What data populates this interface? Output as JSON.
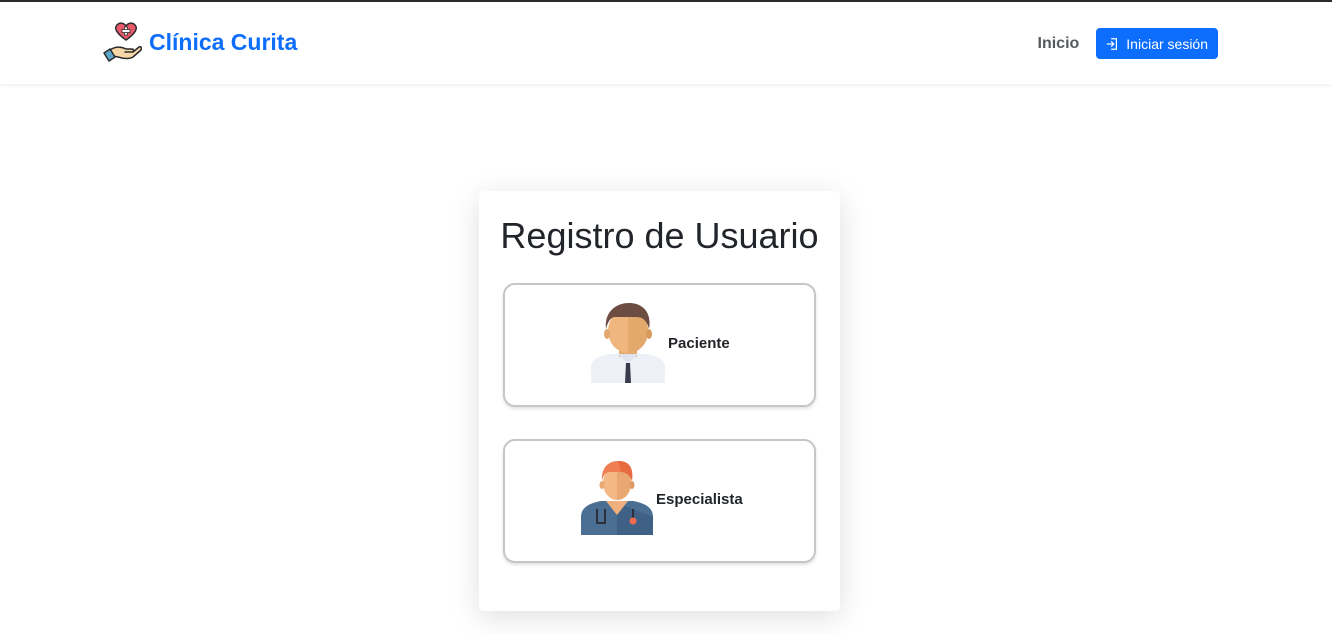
{
  "navbar": {
    "brand_name": "Clínica Curita",
    "brand_icon": "heart-hand-icon",
    "home_link": "Inicio",
    "login_button": "Iniciar sesión",
    "login_icon": "sign-in-icon",
    "brand_color": "#0d6efd"
  },
  "registration": {
    "title": "Registro de Usuario",
    "options": [
      {
        "label": "Paciente",
        "icon": "patient-avatar-icon"
      },
      {
        "label": "Especialista",
        "icon": "doctor-avatar-icon"
      }
    ]
  }
}
